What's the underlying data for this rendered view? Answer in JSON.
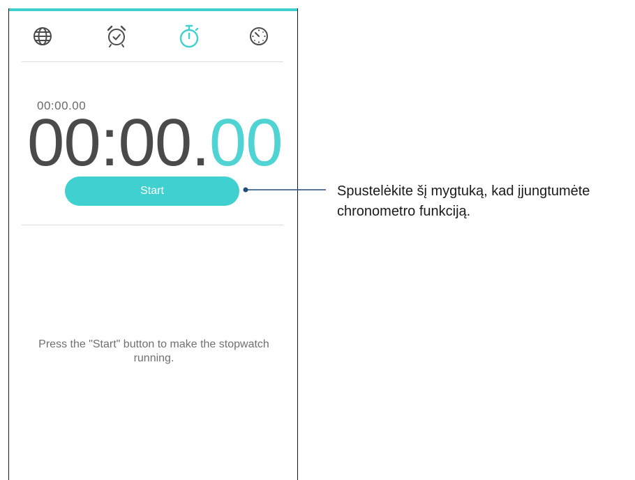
{
  "app": {
    "tabs": [
      {
        "id": "world-clock",
        "icon": "globe-icon"
      },
      {
        "id": "alarm",
        "icon": "alarm-clock-icon"
      },
      {
        "id": "stopwatch",
        "icon": "stopwatch-icon",
        "active": true
      },
      {
        "id": "timer",
        "icon": "timer-icon"
      }
    ],
    "accent_color": "#41d0d0",
    "lap_time": "00:00.00",
    "main_time": {
      "main": "00:00.",
      "hundredths": "00"
    },
    "start_label": "Start",
    "hint": "Press the \"Start\" button to make the stopwatch running."
  },
  "callout": {
    "text_line1": "Spustelėkite šį mygtuką, kad įjungtumėte",
    "text_line2": "chronometro funkciją."
  }
}
